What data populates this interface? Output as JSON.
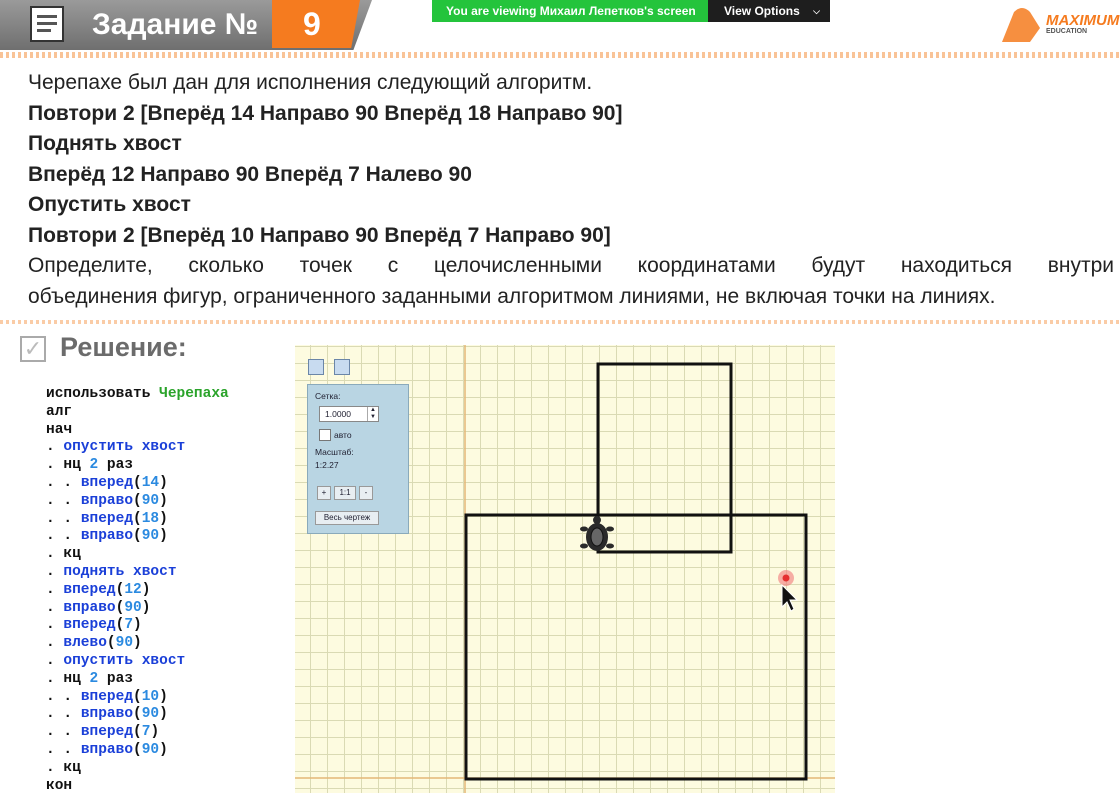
{
  "header": {
    "title": "Задание №",
    "number": "9",
    "logo_text": "MAXIMUM",
    "logo_sub": "EDUCATION",
    "banner_text": "You are viewing Михаил Лепетков's screen",
    "view_options": "View Options"
  },
  "task": {
    "intro": "Черепахе был дан для исполнения следующий алгоритм.",
    "line1": "Повтори 2 [Вперёд  14 Направо 90 Вперёд 18 Направо 90]",
    "line2": "Поднять хвост",
    "line3": "Вперёд 12 Направо 90 Вперёд 7 Налево 90",
    "line4": "Опустить хвост",
    "line5": "Повтори 2 [Вперёд 10 Направо 90 Вперёд 7 Направо 90]",
    "question_line1": "Определите, сколько точек с целочисленными координатами будут находиться внутри",
    "question_line2": "объединения фигур, ограниченного заданными алгоритмом линиями, не включая точки на линиях."
  },
  "solution": {
    "title": "Решение:",
    "code": {
      "l1a": "использовать ",
      "l1b": "Черепаха",
      "l2": "алг",
      "l3": "нач",
      "l4a": ". ",
      "l4b": "опустить хвост",
      "l5a": ". нц ",
      "l5b": "2",
      "l5c": " раз",
      "l6a": ". . ",
      "l6b": "вперед",
      "l6c": "(",
      "l6d": "14",
      "l6e": ")",
      "l7a": ". . ",
      "l7b": "вправо",
      "l7c": "(",
      "l7d": "90",
      "l7e": ")",
      "l8a": ". . ",
      "l8b": "вперед",
      "l8c": "(",
      "l8d": "18",
      "l8e": ")",
      "l9a": ". . ",
      "l9b": "вправо",
      "l9c": "(",
      "l9d": "90",
      "l9e": ")",
      "l10": ". кц",
      "l11a": ". ",
      "l11b": "поднять хвост",
      "l12a": ". ",
      "l12b": "вперед",
      "l12c": "(",
      "l12d": "12",
      "l12e": ")",
      "l13a": ". ",
      "l13b": "вправо",
      "l13c": "(",
      "l13d": "90",
      "l13e": ")",
      "l14a": ". ",
      "l14b": "вперед",
      "l14c": "(",
      "l14d": "7",
      "l14e": ")",
      "l15a": ". ",
      "l15b": "влево",
      "l15c": "(",
      "l15d": "90",
      "l15e": ")",
      "l16a": ". ",
      "l16b": "опустить хвост",
      "l17a": ". нц ",
      "l17b": "2",
      "l17c": " раз",
      "l18a": ". . ",
      "l18b": "вперед",
      "l18c": "(",
      "l18d": "10",
      "l18e": ")",
      "l19a": ". . ",
      "l19b": "вправо",
      "l19c": "(",
      "l19d": "90",
      "l19e": ")",
      "l20a": ". . ",
      "l20b": "вперед",
      "l20c": "(",
      "l20d": "7",
      "l20e": ")",
      "l21a": ". . ",
      "l21b": "вправо",
      "l21c": "(",
      "l21d": "90",
      "l21e": ")",
      "l22": ". кц",
      "l23": "кон"
    }
  },
  "turtle_panel": {
    "grid_label": "Сетка:",
    "grid_value": "1.0000",
    "auto_label": "авто",
    "scale_label": "Масштаб:",
    "scale_value": "1:2.27",
    "plus": "+",
    "one_to_one": "1:1",
    "minus": "-",
    "full_drawing": "Весь чертеж"
  },
  "colors": {
    "accent_orange": "#f57b1f",
    "banner_green": "#24c43c",
    "code_keyword": "#1a3fd8",
    "code_number": "#2b8ae0",
    "code_module": "#2aa32a",
    "grid_bg": "#fdfbe0"
  }
}
